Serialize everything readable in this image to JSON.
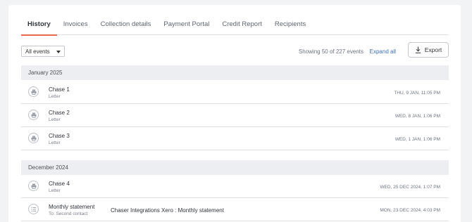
{
  "tabs": [
    {
      "label": "History",
      "active": true
    },
    {
      "label": "Invoices",
      "active": false
    },
    {
      "label": "Collection details",
      "active": false
    },
    {
      "label": "Payment Portal",
      "active": false
    },
    {
      "label": "Credit Report",
      "active": false
    },
    {
      "label": "Recipients",
      "active": false
    }
  ],
  "toolbar": {
    "filter_value": "All events",
    "showing_text": "Showing 50 of 227 events",
    "expand_label": "Expand all",
    "export_label": "Export"
  },
  "groups": [
    {
      "label": "January 2025",
      "events": [
        {
          "title": "Chase 1",
          "subtitle": "Letter",
          "description": "",
          "date": "THU, 9 JAN, 11:05 PM",
          "icon": "printer-icon"
        },
        {
          "title": "Chase 2",
          "subtitle": "Letter",
          "description": "",
          "date": "WED, 8 JAN, 1:06 PM",
          "icon": "printer-icon"
        },
        {
          "title": "Chase 3",
          "subtitle": "Letter",
          "description": "",
          "date": "WED, 1 JAN, 1:06 PM",
          "icon": "printer-icon"
        }
      ]
    },
    {
      "label": "December 2024",
      "events": [
        {
          "title": "Chase 4",
          "subtitle": "Letter",
          "description": "",
          "date": "WED, 25 DEC 2024, 1:07 PM",
          "icon": "printer-icon"
        },
        {
          "title": "Monthly statement",
          "subtitle": "To: Second contact",
          "description": "Chaser Integrations Xero : Monthly statement",
          "date": "MON, 23 DEC 2024, 4:03 PM",
          "icon": "list-icon"
        }
      ]
    }
  ],
  "colors": {
    "accent": "#e8684a",
    "link": "#3c6fb6",
    "group_bg": "#eceef1",
    "page_bg": "#f2f3f5"
  }
}
